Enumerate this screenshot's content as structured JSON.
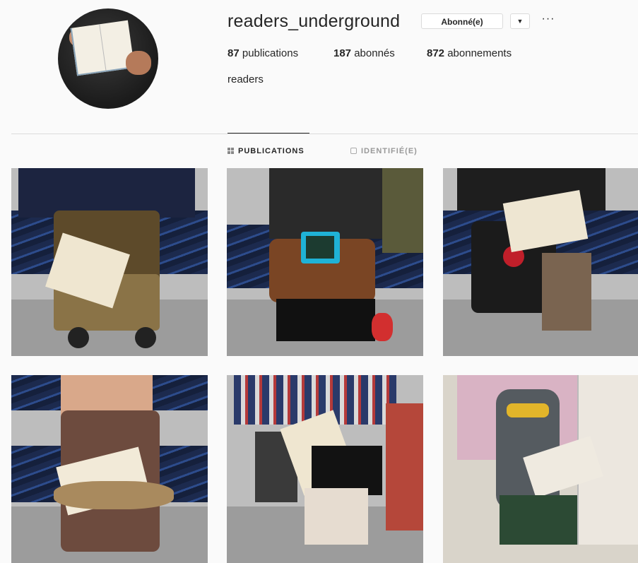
{
  "profile": {
    "username": "readers_underground",
    "follow_label": "Abonné(e)",
    "caret_icon": "chevron-down-icon",
    "more_icon": "more-icon",
    "more_glyph": "···",
    "stats": {
      "posts_count": "87",
      "posts_label": "publications",
      "followers_count": "187",
      "followers_label": "abonnés",
      "following_count": "872",
      "following_label": "abonnements"
    },
    "bio_name": "readers"
  },
  "tabs": [
    {
      "label": "PUBLICATIONS",
      "icon": "grid-icon",
      "active": true
    },
    {
      "label": "IDENTIFIÉ(E)",
      "icon": "tag-icon",
      "active": false
    }
  ],
  "colors": {
    "background": "#fafafa",
    "text": "#262626",
    "muted": "#999999",
    "border": "#dbdbdb"
  }
}
